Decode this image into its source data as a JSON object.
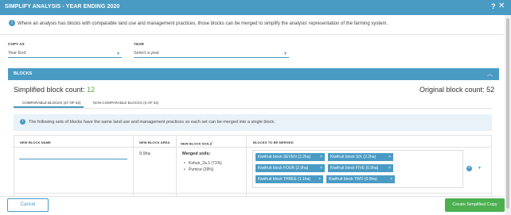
{
  "dialog": {
    "title": "SIMPLIFY ANALYSIS - YEAR ENDING 2020",
    "help_label": "?",
    "close_label": "✕",
    "info_text": "Where an analysis has blocks with comparable land use and management practices, those blocks can be merged to simplify the analysis' representation of the farming system."
  },
  "form": {
    "copy_as_label": "COPY AS",
    "copy_as_value": "Year End",
    "year_label": "YEAR",
    "year_placeholder": "Select a year"
  },
  "blocks": {
    "header_label": "BLOCKS",
    "simplified_label": "Simplified block count:",
    "simplified_count": "12",
    "original_label": "Original block count:",
    "original_count": "52",
    "tabs": [
      {
        "label": "COMPARABLE BLOCKS (47 OF 52)",
        "active": true
      },
      {
        "label": "NON-COMPARABLE BLOCKS (5 OF 52)",
        "active": false
      }
    ],
    "note_text": "The following sets of blocks have the same land use and management practices so each set can be merged into a single block.",
    "columns": {
      "new_block_name": "NEW BLOCK NAME",
      "new_block_area": "NEW BLOCK AREA",
      "new_block_soils": "NEW BLOCK SOILS",
      "new_block_soils_sup": "i",
      "blocks_to_merge": "BLOCKS TO BE MERGED"
    },
    "row": {
      "area": "9.9ha",
      "soils_title": "Merged soils:",
      "soils": [
        "Kohun_2a.1 (71%)",
        "Pumice (29%)"
      ],
      "merge_blocks": [
        "Kiwifruit block SEVEN (2.2ha)",
        "Kiwifruit block SIX (2.2ha)",
        "Kiwifruit block FOUR (2.9ha)",
        "Kiwifruit block FIVE (0.9ha)",
        "Kiwifruit block THREE (1.1ha)",
        "Kiwifruit block TWO (0.9ha)"
      ],
      "remove_label": "×"
    }
  },
  "footer": {
    "cancel_label": "Cancel",
    "create_label": "Create Simplified Copy"
  },
  "colors": {
    "accent": "#4a9bc4",
    "success": "#4caf50",
    "count_green": "#5aa64c"
  }
}
